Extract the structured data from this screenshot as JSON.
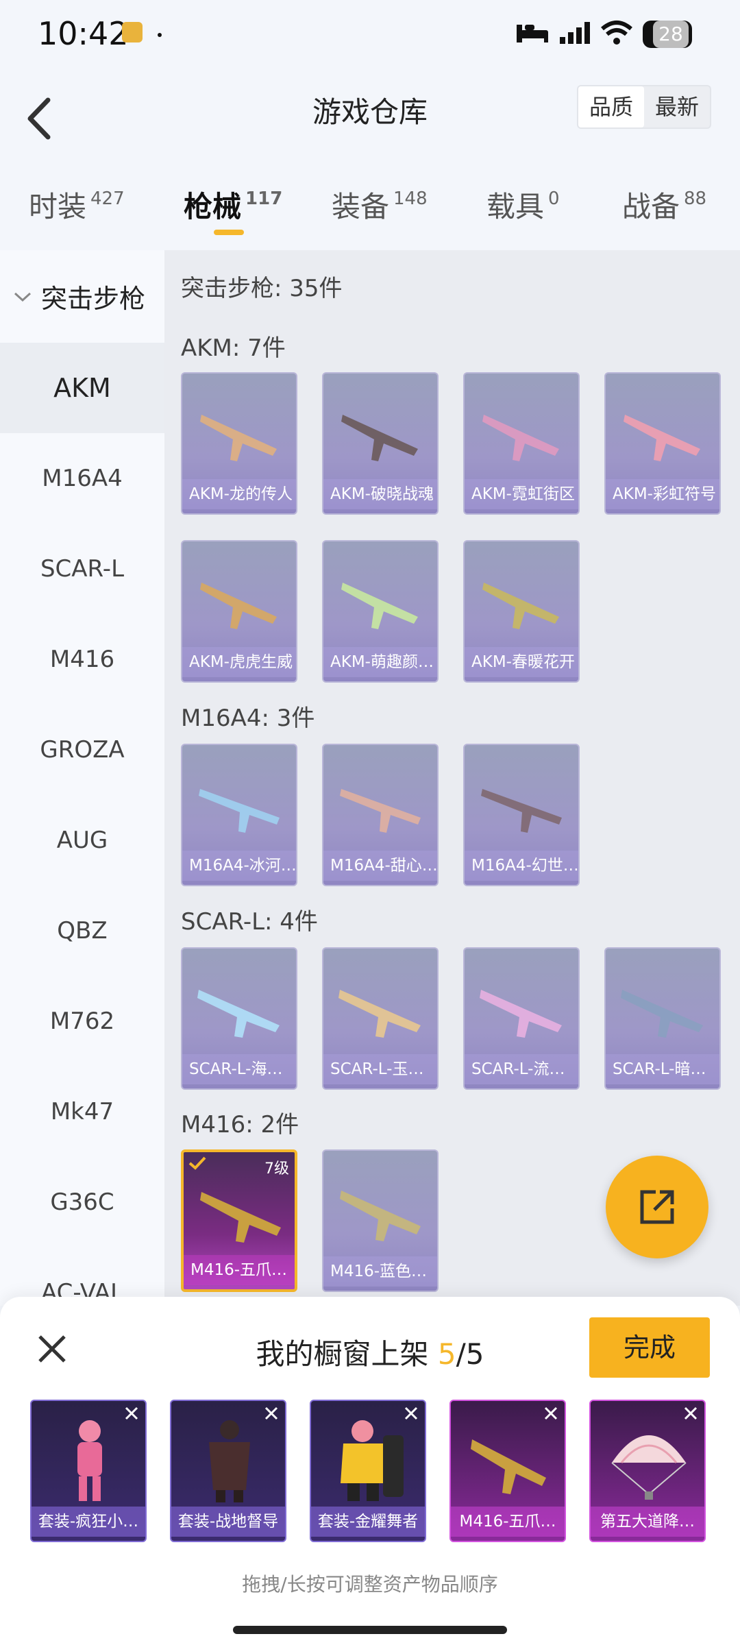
{
  "status_bar": {
    "time": "10:42",
    "battery": "28"
  },
  "nav": {
    "title": "游戏仓库",
    "sort_quality": "品质",
    "sort_newest": "最新"
  },
  "tabs": [
    {
      "label": "时装",
      "count": "427"
    },
    {
      "label": "枪械",
      "count": "117"
    },
    {
      "label": "装备",
      "count": "148"
    },
    {
      "label": "载具",
      "count": "0"
    },
    {
      "label": "战备",
      "count": "88"
    }
  ],
  "sidebar": {
    "category": "突击步枪",
    "items": [
      "AKM",
      "M16A4",
      "SCAR-L",
      "M416",
      "GROZA",
      "AUG",
      "QBZ",
      "M762",
      "Mk47",
      "G36C",
      "AC-VAL"
    ]
  },
  "main": {
    "category_header": "突击步枪: 35件",
    "groups": [
      {
        "title": "AKM: 7件",
        "items": [
          "AKM-龙的传人",
          "AKM-破晓战魂",
          "AKM-霓虹街区",
          "AKM-彩虹符号",
          "AKM-虎虎生威",
          "AKM-萌趣颜…",
          "AKM-春暖花开"
        ]
      },
      {
        "title": "M16A4: 3件",
        "items": [
          "M16A4-冰河…",
          "M16A4-甜心…",
          "M16A4-幻世…"
        ]
      },
      {
        "title": "SCAR-L: 4件",
        "items": [
          "SCAR-L-海…",
          "SCAR-L-玉…",
          "SCAR-L-流…",
          "SCAR-L-暗…"
        ]
      },
      {
        "title": "M416: 2件",
        "items": [
          "M416-五爪…",
          "M416-蓝色…"
        ],
        "selected_level": "7级"
      }
    ]
  },
  "sheet": {
    "title_prefix": "我的橱窗上架 ",
    "count_current": "5",
    "count_total": "/5",
    "done_label": "完成",
    "items": [
      "套装-疯狂小…",
      "套装-战地督导",
      "套装-金耀舞者",
      "M416-五爪…",
      "第五大道降…"
    ],
    "hint": "拖拽/长按可调整资产物品顺序"
  },
  "colors": {
    "accent": "#f7b21f",
    "card_purple": "#9e97c8",
    "legendary": "#b047bf"
  }
}
